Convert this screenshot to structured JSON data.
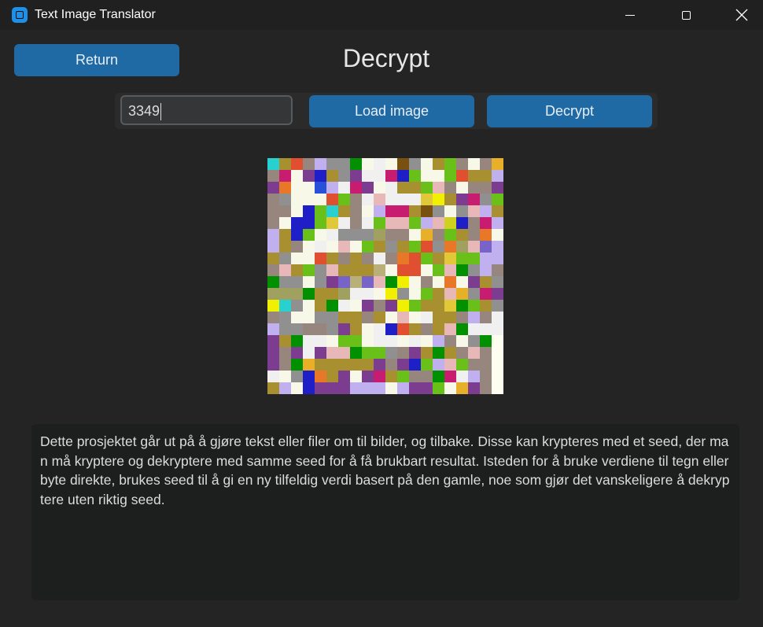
{
  "window": {
    "title": "Text Image Translator",
    "controls": [
      "minimize-icon",
      "maximize-icon",
      "close-icon"
    ]
  },
  "header": {
    "return_label": "Return",
    "title": "Decrypt"
  },
  "toolbar": {
    "seed_value": "3349",
    "load_label": "Load image",
    "decrypt_label": "Decrypt"
  },
  "encoded_image": {
    "grid_size": 20,
    "palette": {
      "a": "#96867e",
      "b": "#a89030",
      "c": "#e05030",
      "d": "#7c3c90",
      "e": "#c0b0f0",
      "f": "#1f1fc8",
      "g": "#28d0d0",
      "h": "#e8b028",
      "i": "#f8f8e8",
      "j": "#68c018",
      "k": "#c81c70",
      "l": "#785010",
      "m": "#e0c838",
      "n": "#e8b8b8",
      "o": "#909090",
      "p": "#009000",
      "q": "#5c4a06",
      "r": "#2850d8",
      "s": "#b8b078",
      "t": "#f0f000",
      "u": "#f0f0f0",
      "v": "#3ec08c",
      "w": "#e87828",
      "x": "#7864c8",
      "y": "#a0a060",
      "z": "#d0d020",
      "A": "#fdfdf0",
      "B": "#b89ce8"
    },
    "rows": [
      "gbcaeoopiuiloibjaiah",
      "akidfboduukfjiijcbbe",
      "dwiireukdiubbjnaiaad",
      "aoiiicjaunuuumtbdkoj",
      "aaifjgbaiekkbloioneb",
      "aiffjmuaujnnjenzfake",
      "ebfjiuoooyaaihajbawi",
      "ebaiuinijbobjcowynxe",
      "boiicbabauawcjbmjjee",
      "anbjonbbbsiccijnpoea",
      "pooiodxsxnptiaiwidbo",
      "yyypbbyuuitoijbnhokd",
      "tgoibpuidadtjbbmpjbo",
      "aoiioobbabiniubbaeau",
      "eooaaodbiufcbabnpuuu",
      "dbpuuijjiuuiuieaiopA",
      "dadudnnpjjoadbpbanaA",
      "daphbbbbbdadfjenjaaA",
      "uiofwbdidkbjaapkueaA",
      "beifdddeeeieddjihdaA"
    ]
  },
  "output": {
    "text": "Dette prosjektet går ut på å gjøre tekst eller filer om til bilder, og tilbake. Disse kan krypteres med et seed, der man må kryptere og dekryptere med samme seed for å få brukbart resultat. Isteden for å bruke verdiene til tegn eller byte direkte, brukes seed til å gi en ny tilfeldig verdi basert på den gamle, noe som gjør det vanskeligere å dekryptere uten riktig seed."
  }
}
